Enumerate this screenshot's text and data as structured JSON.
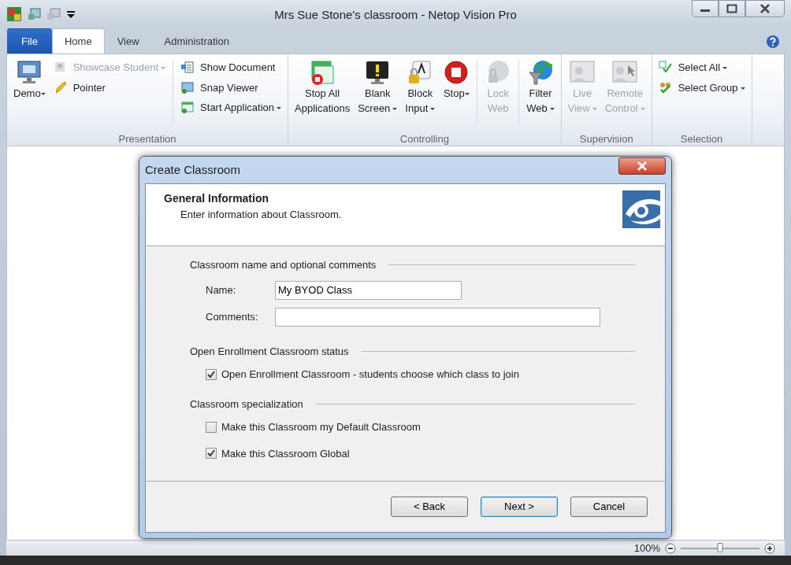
{
  "window": {
    "title": "Mrs Sue Stone's classroom - Netop Vision Pro"
  },
  "ribbon_tabs": [
    {
      "label": "File",
      "kind": "file",
      "selected": false
    },
    {
      "label": "Home",
      "kind": "tab",
      "selected": true
    },
    {
      "label": "View",
      "kind": "tab",
      "selected": false
    },
    {
      "label": "Administration",
      "kind": "tab",
      "selected": false
    }
  ],
  "ribbon_groups": [
    {
      "label": "Presentation",
      "columns": [
        {
          "kind": "large",
          "items": [
            {
              "label": "Demo",
              "dropdown": true,
              "disabled": false
            }
          ]
        },
        {
          "kind": "small",
          "items": [
            {
              "label": "Showcase Student",
              "dropdown": true,
              "disabled": true
            },
            {
              "label": "Pointer",
              "dropdown": false,
              "disabled": false
            }
          ]
        },
        {
          "kind": "separator"
        },
        {
          "kind": "small",
          "items": [
            {
              "label": "Show Document",
              "dropdown": false,
              "disabled": false
            },
            {
              "label": "Snap Viewer",
              "dropdown": false,
              "disabled": false
            },
            {
              "label": "Start Application",
              "dropdown": true,
              "disabled": false
            }
          ]
        }
      ]
    },
    {
      "label": "Controlling",
      "columns": [
        {
          "kind": "large",
          "items": [
            {
              "label": "Stop All\nApplications",
              "dropdown": false,
              "disabled": false
            }
          ]
        },
        {
          "kind": "large",
          "items": [
            {
              "label": "Blank\nScreen",
              "dropdown": true,
              "disabled": false
            }
          ]
        },
        {
          "kind": "large",
          "items": [
            {
              "label": "Block\nInput",
              "dropdown": true,
              "disabled": false
            }
          ]
        },
        {
          "kind": "large",
          "items": [
            {
              "label": "Stop",
              "dropdown": true,
              "disabled": false
            }
          ]
        },
        {
          "kind": "separator"
        },
        {
          "kind": "large",
          "items": [
            {
              "label": "Lock\nWeb",
              "dropdown": false,
              "disabled": true
            }
          ]
        },
        {
          "kind": "separator"
        },
        {
          "kind": "large",
          "items": [
            {
              "label": "Filter\nWeb",
              "dropdown": true,
              "disabled": false
            }
          ]
        }
      ]
    },
    {
      "label": "Supervision",
      "columns": [
        {
          "kind": "large",
          "items": [
            {
              "label": "Live\nView",
              "dropdown": true,
              "disabled": true
            }
          ]
        },
        {
          "kind": "large",
          "items": [
            {
              "label": "Remote\nControl",
              "dropdown": true,
              "disabled": true
            }
          ]
        }
      ]
    },
    {
      "label": "Selection",
      "columns": [
        {
          "kind": "small",
          "items": [
            {
              "label": "Select All",
              "dropdown": true,
              "disabled": false
            },
            {
              "label": "Select Group",
              "dropdown": true,
              "disabled": false
            }
          ]
        }
      ]
    }
  ],
  "dialog": {
    "title": "Create Classroom",
    "header": {
      "title": "General Information",
      "subtitle": "Enter information about Classroom."
    },
    "sections": [
      {
        "title": "Classroom name and optional comments",
        "kind": "fields",
        "fields": [
          {
            "label": "Name:",
            "value": "My BYOD Class",
            "wide": false
          },
          {
            "label": "Comments:",
            "wide": true
          }
        ]
      },
      {
        "title": "Open Enrollment Classroom status",
        "kind": "checkboxes",
        "checkboxes": [
          {
            "label": "Open Enrollment Classroom - students choose which class to join",
            "checked": true
          }
        ]
      },
      {
        "title": "Classroom specialization",
        "kind": "checkboxes",
        "checkboxes": [
          {
            "label": "Make this Classroom my Default Classroom",
            "checked": false
          },
          {
            "label": "Make this Classroom Global",
            "checked": true
          }
        ]
      }
    ],
    "buttons": [
      {
        "label": "< Back",
        "default": false
      },
      {
        "label": "Next >",
        "default": true
      },
      {
        "label": "Cancel",
        "default": false
      }
    ]
  },
  "status_bar": {
    "zoom": "100%",
    "zoom_slider": {
      "level": 0.5
    }
  }
}
